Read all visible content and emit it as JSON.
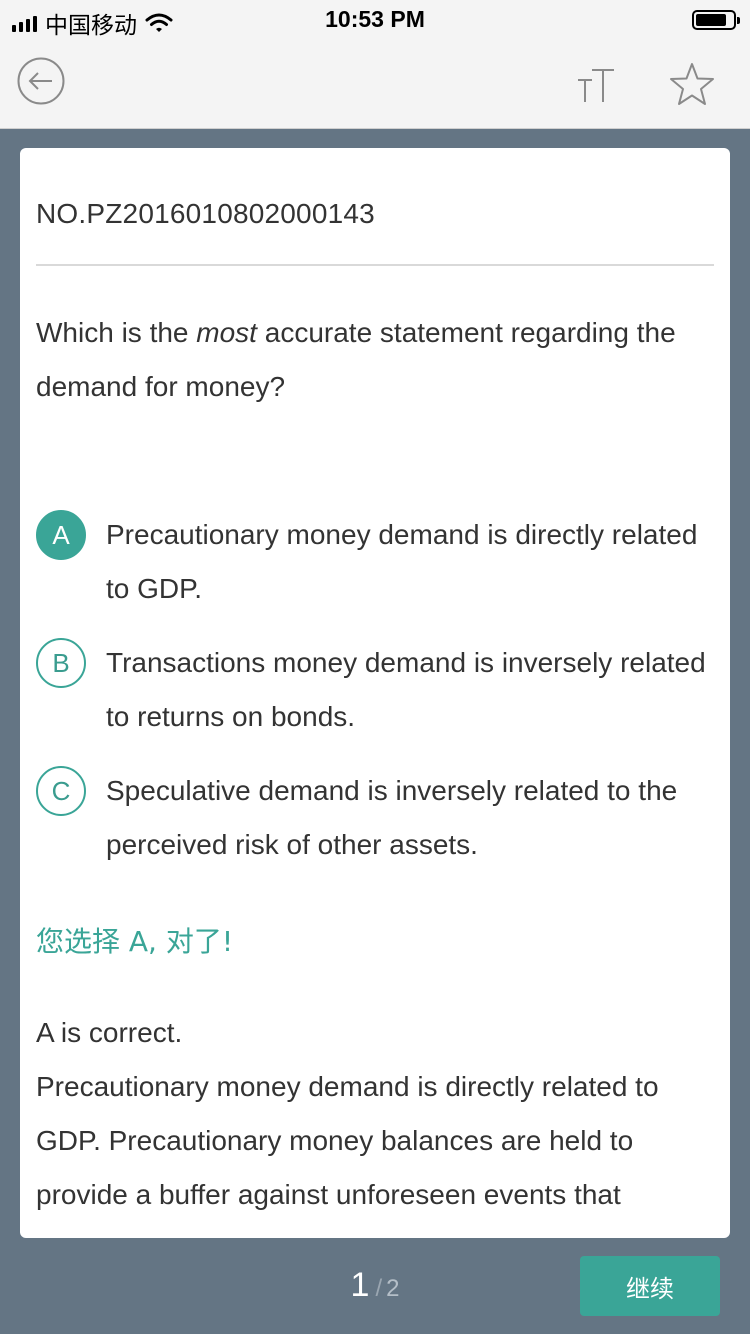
{
  "status": {
    "carrier": "中国移动",
    "time": "10:53 PM"
  },
  "nav": {
    "back_icon": "back-arrow-circle-icon",
    "font_icon": "text-size-icon",
    "star_icon": "star-outline-icon"
  },
  "question": {
    "number": "NO.PZ2016010802000143",
    "text_before": "Which is the ",
    "text_emphasis": "most",
    "text_after": " accurate statement regarding the demand for money?"
  },
  "options": [
    {
      "letter": "A",
      "text": "Precautionary money demand is directly related to GDP.",
      "selected": true
    },
    {
      "letter": "B",
      "text": "Transactions money demand is inversely related to returns on bonds.",
      "selected": false
    },
    {
      "letter": "C",
      "text": "Speculative demand is inversely related to the perceived risk of other assets.",
      "selected": false
    }
  ],
  "result": "您选择 A, 对了!",
  "explanation": {
    "line1": "A  is correct.",
    "line2": "Precautionary money demand is directly related to GDP. Precautionary money balances are held to provide a buffer against unforeseen events that"
  },
  "footer": {
    "current_page": "1",
    "separator": "/",
    "total_pages": "2",
    "continue_label": "继续"
  },
  "colors": {
    "accent": "#3aa597",
    "background": "#647584"
  }
}
